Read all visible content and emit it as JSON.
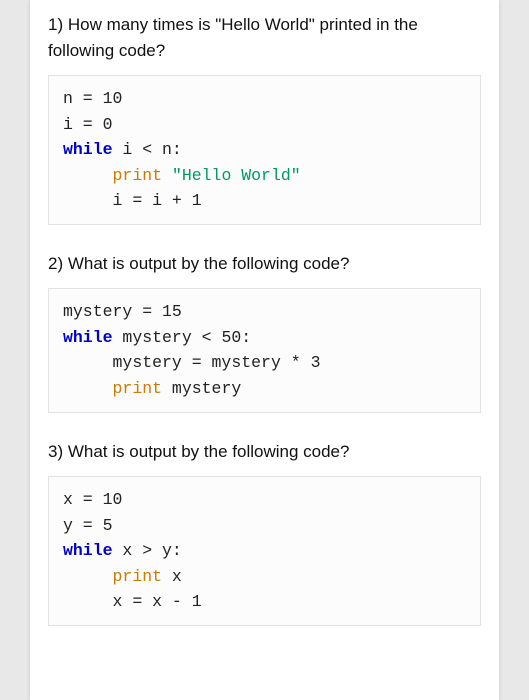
{
  "q1": {
    "text": "1) How many times is \"Hello World\" printed in the following code?",
    "code": {
      "l1a": "n",
      "l1b": " = ",
      "l1c": "10",
      "l2a": "i",
      "l2b": " = ",
      "l2c": "0",
      "l3a": "while",
      "l3b": " i < n:",
      "l4pad": "     ",
      "l4a": "print",
      "l4b": " ",
      "l4c": "\"Hello World\"",
      "l5pad": "     ",
      "l5a": "i = i + ",
      "l5b": "1"
    }
  },
  "q2": {
    "text": "2) What is output by the following code?",
    "code": {
      "l1a": "mystery = ",
      "l1b": "15",
      "l2a": "while",
      "l2b": " mystery < ",
      "l2c": "50",
      "l2d": ":",
      "l3pad": "     ",
      "l3a": "mystery = mystery * ",
      "l3b": "3",
      "l4pad": "     ",
      "l4a": "print",
      "l4b": " mystery"
    }
  },
  "q3": {
    "text": "3) What is output by the following code?",
    "code": {
      "l1a": "x = ",
      "l1b": "10",
      "l2a": "y = ",
      "l2b": "5",
      "l3a": "while",
      "l3b": " x > y:",
      "l4pad": "     ",
      "l4a": "print",
      "l4b": " x",
      "l5pad": "     ",
      "l5a": "x = x - ",
      "l5b": "1"
    }
  }
}
